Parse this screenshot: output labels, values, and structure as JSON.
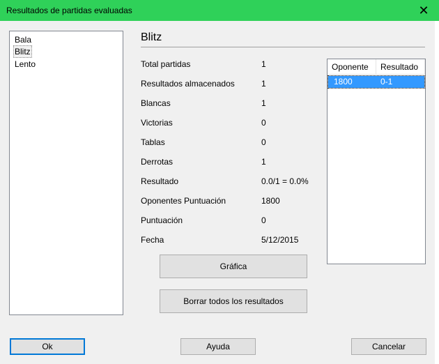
{
  "window": {
    "title": "Resultados de partidas evaluadas"
  },
  "icons": {
    "close": "close-icon"
  },
  "game_types": [
    "Bala",
    "Blitz",
    "Lento"
  ],
  "selected_type": "Blitz",
  "section_title": "Blitz",
  "stats": [
    {
      "label": "Total partidas",
      "value": "1"
    },
    {
      "label": "Resultados almacenados",
      "value": "1"
    },
    {
      "label": "Blancas",
      "value": "1"
    },
    {
      "label": "Victorias",
      "value": "0"
    },
    {
      "label": "Tablas",
      "value": "0"
    },
    {
      "label": "Derrotas",
      "value": "1"
    },
    {
      "label": "Resultado",
      "value": "0.0/1 = 0.0%"
    },
    {
      "label": "Oponentes Puntuación",
      "value": "1800"
    },
    {
      "label": "Puntuación",
      "value": "0"
    },
    {
      "label": "Fecha",
      "value": "5/12/2015"
    }
  ],
  "table": {
    "headers": [
      "Oponente",
      "Resultado"
    ],
    "rows": [
      [
        "1800",
        "0-1"
      ]
    ]
  },
  "buttons": {
    "chart": "Gráfica",
    "clear": "Borrar todos los resultados",
    "ok": "Ok",
    "help": "Ayuda",
    "cancel": "Cancelar"
  },
  "colors": {
    "titlebar": "#2fd159",
    "selection": "#3399ff",
    "default_button_border": "#0078d7"
  }
}
